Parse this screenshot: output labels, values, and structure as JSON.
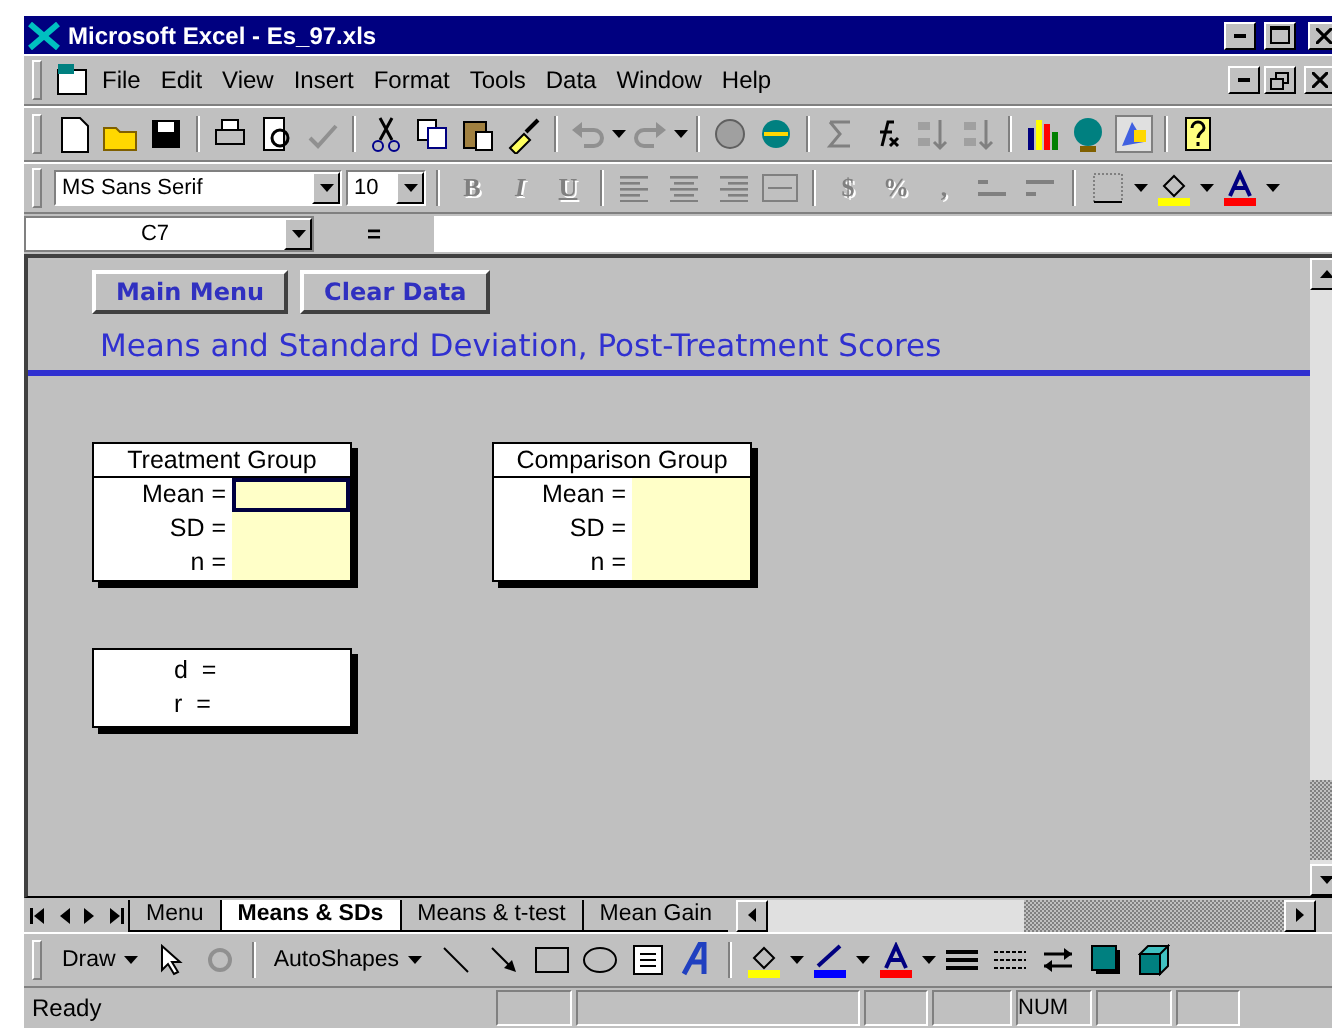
{
  "window": {
    "title": "Microsoft Excel - Es_97.xls"
  },
  "menu": [
    {
      "label": "File"
    },
    {
      "label": "Edit"
    },
    {
      "label": "View"
    },
    {
      "label": "Insert"
    },
    {
      "label": "Format"
    },
    {
      "label": "Tools"
    },
    {
      "label": "Data"
    },
    {
      "label": "Window"
    },
    {
      "label": "Help"
    }
  ],
  "formatting": {
    "font": "MS Sans Serif",
    "size": "10",
    "style_buttons": [
      {
        "label": "B",
        "disabled": true
      },
      {
        "label": "I",
        "disabled": true
      },
      {
        "label": "U",
        "disabled": true
      }
    ],
    "number_buttons": [
      {
        "label": "$"
      },
      {
        "label": "%"
      },
      {
        "label": ","
      }
    ]
  },
  "formula_bar": {
    "name_box": "C7",
    "equals": "="
  },
  "sheet": {
    "buttons": [
      {
        "label": "Main Menu"
      },
      {
        "label": "Clear Data"
      }
    ],
    "heading": "Means and Standard Deviation, Post-Treatment Scores",
    "groups": [
      {
        "title": "Treatment Group",
        "rows": [
          {
            "label": "Mean =",
            "selected": true
          },
          {
            "label": "SD =",
            "selected": false
          },
          {
            "label": "n =",
            "selected": false
          }
        ]
      },
      {
        "title": "Comparison Group",
        "rows": [
          {
            "label": "Mean =",
            "selected": false
          },
          {
            "label": "SD =",
            "selected": false
          },
          {
            "label": "n =",
            "selected": false
          }
        ]
      }
    ],
    "effect_rows": [
      {
        "label": "d  ="
      },
      {
        "label": "r  ="
      }
    ]
  },
  "sheet_tabs": [
    {
      "label": "Menu",
      "selected": false
    },
    {
      "label": "Means & SDs",
      "selected": true
    },
    {
      "label": "Means & t-test",
      "selected": false
    },
    {
      "label": "Mean Gain",
      "selected": false
    }
  ],
  "drawing_toolbar": {
    "draw": "Draw",
    "autoshapes": "AutoShapes"
  },
  "status_bar": {
    "text": "Ready",
    "indicators": [
      {
        "label": "NUM"
      }
    ]
  }
}
